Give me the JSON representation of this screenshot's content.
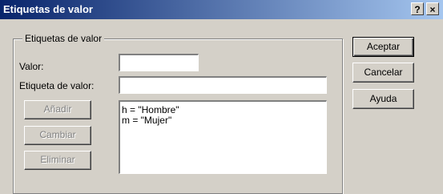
{
  "window": {
    "title": "Etiquetas de valor",
    "help_glyph": "?",
    "close_glyph": "×"
  },
  "group": {
    "legend": "Etiquetas de valor"
  },
  "form": {
    "value_label": "Valor:",
    "value_input": "",
    "label_label": "Etiqueta de valor:",
    "label_input": ""
  },
  "buttons": {
    "add": "Añadir",
    "change": "Cambiar",
    "remove": "Eliminar",
    "ok": "Aceptar",
    "cancel": "Cancelar",
    "help": "Ayuda"
  },
  "list": {
    "items": [
      "h = \"Hombre\"",
      "m = \"Mujer\""
    ]
  }
}
